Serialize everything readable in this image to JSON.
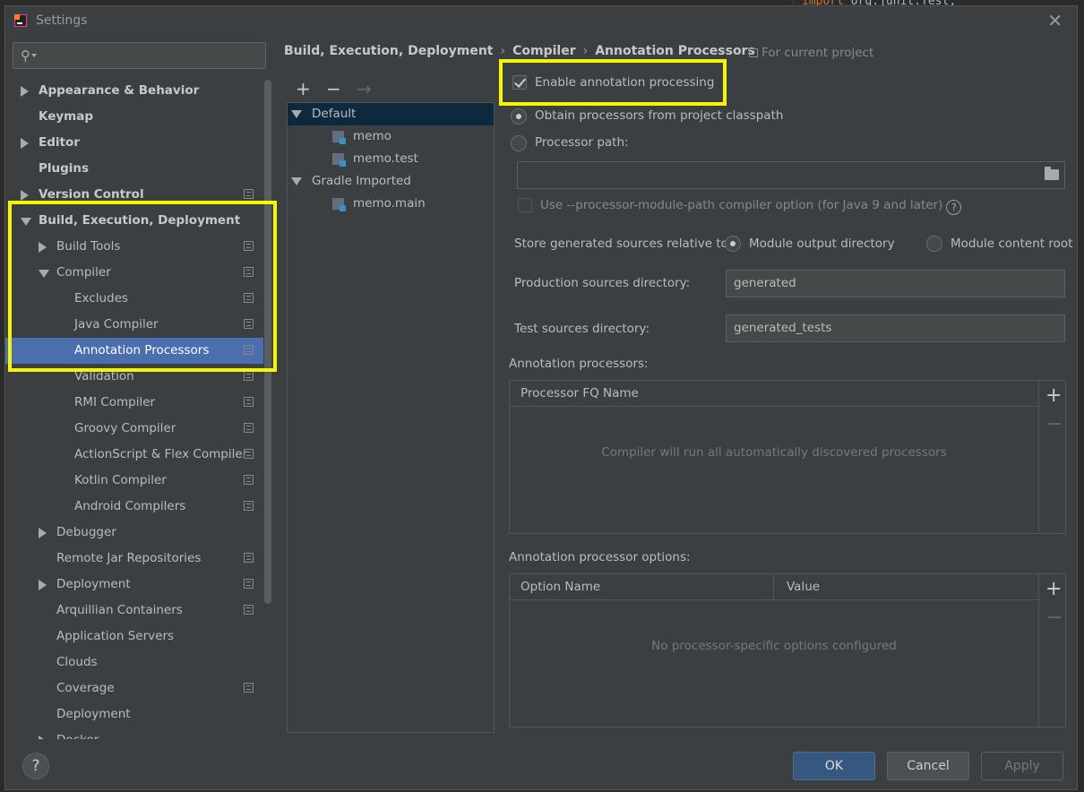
{
  "window": {
    "title": "Settings",
    "close": "✕"
  },
  "background": {
    "code_keyword": "import",
    "code_rest": " org.junit.Test;"
  },
  "search": {
    "placeholder": ""
  },
  "tree": {
    "items": [
      {
        "label": "Appearance & Behavior",
        "bold": true,
        "expand": "right"
      },
      {
        "label": "Keymap",
        "bold": true
      },
      {
        "label": "Editor",
        "bold": true,
        "expand": "right"
      },
      {
        "label": "Plugins",
        "bold": true
      },
      {
        "label": "Version Control",
        "bold": true,
        "expand": "right",
        "project_icon": true
      },
      {
        "label": "Build, Execution, Deployment",
        "bold": true,
        "expand": "down"
      },
      {
        "label": "Build Tools",
        "expand": "right",
        "project_icon": true
      },
      {
        "label": "Compiler",
        "expand": "down",
        "project_icon": true
      },
      {
        "label": "Excludes",
        "project_icon": true
      },
      {
        "label": "Java Compiler",
        "project_icon": true
      },
      {
        "label": "Annotation Processors",
        "project_icon": true,
        "selected": true
      },
      {
        "label": "Validation",
        "project_icon": true
      },
      {
        "label": "RMI Compiler",
        "project_icon": true
      },
      {
        "label": "Groovy Compiler",
        "project_icon": true
      },
      {
        "label": "ActionScript & Flex Compiler",
        "project_icon": true
      },
      {
        "label": "Kotlin Compiler",
        "project_icon": true
      },
      {
        "label": "Android Compilers",
        "project_icon": true
      },
      {
        "label": "Debugger",
        "expand": "right"
      },
      {
        "label": "Remote Jar Repositories",
        "project_icon": true
      },
      {
        "label": "Deployment",
        "expand": "right",
        "project_icon": true
      },
      {
        "label": "Arquillian Containers",
        "project_icon": true
      },
      {
        "label": "Application Servers"
      },
      {
        "label": "Clouds"
      },
      {
        "label": "Coverage",
        "project_icon": true
      },
      {
        "label": "Deployment"
      },
      {
        "label": "Docker",
        "expand": "right"
      }
    ]
  },
  "breadcrumb": {
    "part1": "Build, Execution, Deployment",
    "sep": "›",
    "part2": "Compiler",
    "part3": "Annotation Processors"
  },
  "for_current_project": "For current project",
  "profiles": {
    "toolbar": {
      "add": "+",
      "remove": "−",
      "move": "→"
    },
    "items": [
      {
        "label": "Default",
        "type": "group",
        "selected": true
      },
      {
        "label": "memo",
        "type": "module"
      },
      {
        "label": "memo.test",
        "type": "module"
      },
      {
        "label": "Gradle Imported",
        "type": "group"
      },
      {
        "label": "memo.main",
        "type": "module"
      }
    ]
  },
  "settings": {
    "enable_annotation_processing": "Enable annotation processing",
    "enable_checked": true,
    "obtain_from_classpath": "Obtain processors from project classpath",
    "processor_path": "Processor path:",
    "processor_path_value": "",
    "use_module_path": "Use --processor-module-path compiler option (for Java 9 and later)",
    "help_glyph": "?",
    "store_relative_to": "Store generated sources relative to:",
    "module_output_dir": "Module output directory",
    "module_content_root": "Module content root",
    "production_sources_dir_label": "Production sources directory:",
    "production_sources_dir_value": "generated",
    "test_sources_dir_label": "Test sources directory:",
    "test_sources_dir_value": "generated_tests"
  },
  "processors_table": {
    "title": "Annotation processors:",
    "columns": [
      "Processor FQ Name"
    ],
    "empty_text": "Compiler will run all automatically discovered processors",
    "add": "+",
    "remove": "−"
  },
  "options_table": {
    "title": "Annotation processor options:",
    "columns": [
      "Option Name",
      "Value"
    ],
    "empty_text": "No processor-specific options configured",
    "add": "+",
    "remove": "−"
  },
  "footer": {
    "help": "?",
    "ok": "OK",
    "cancel": "Cancel",
    "apply": "Apply"
  },
  "colors": {
    "highlight": "#f7f500",
    "selection": "#4b6eaf",
    "ok_button": "#365880"
  }
}
